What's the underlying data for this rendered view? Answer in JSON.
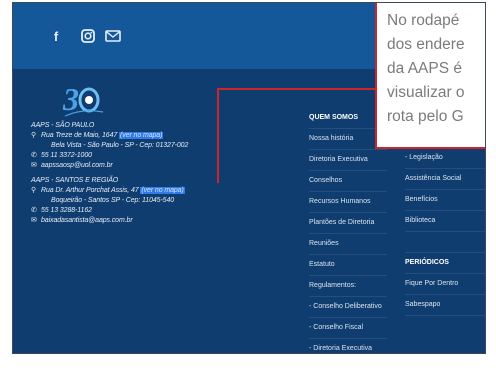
{
  "social": {
    "facebook": "f",
    "icons": [
      "facebook-icon",
      "instagram-icon",
      "mail-icon"
    ]
  },
  "logo": {
    "number": "30",
    "caption": ""
  },
  "addresses": {
    "sp_title": "AAPS - SÃO PAULO",
    "sp_line1": "Rua Treze de Maio, 1647",
    "sp_map_link": "(ver no mapa)",
    "sp_line2": "Bela Vista - São Paulo - SP - Cep: 01327-002",
    "sp_phone": "55 11 3372-1000",
    "sp_email": "aapssaosp@uol.com.br",
    "santos_title": "AAPS - SANTOS E REGIÃO",
    "santos_line1": "Rua Dr. Arthur Porchat Assis, 47",
    "santos_map_link": "(ver no mapa)",
    "santos_line2": "Boqueirão - Santos SP - Cep: 11045-540",
    "santos_phone": "55 13 3288-1162",
    "santos_email": "baixadasantista@aaps.com.br"
  },
  "menu_col1": [
    {
      "label": "QUEM SOMOS",
      "head": true
    },
    {
      "label": "Nossa história"
    },
    {
      "label": "Diretoria Executiva"
    },
    {
      "label": "Conselhos"
    },
    {
      "label": "Recursos Humanos"
    },
    {
      "label": "Plantões de Diretoria"
    },
    {
      "label": "Reuniões"
    },
    {
      "label": "Estatuto"
    },
    {
      "label": "Regulamentos:"
    },
    {
      "label": "- Conselho Deliberativo"
    },
    {
      "label": "- Conselho Fiscal"
    },
    {
      "label": "- Diretoria Executiva"
    }
  ],
  "menu_col2": [
    {
      "label": "- Legislação"
    },
    {
      "label": "Assistência Social"
    },
    {
      "label": "Benefícios"
    },
    {
      "label": "Biblioteca"
    },
    {
      "label": ""
    },
    {
      "label": "PERIÓDICOS",
      "head": true
    },
    {
      "label": "Fique Por Dentro"
    },
    {
      "label": "Sabespapo"
    }
  ],
  "tooltip": {
    "lines": [
      "No rodapé",
      "dos endere",
      "da AAPS é",
      "visualizar o",
      "rota pelo G"
    ]
  },
  "colors": {
    "topbar": "#15589a",
    "footer": "#0f3d70",
    "highlight": "#2f7ae6",
    "callout_border": "#d0242b"
  }
}
